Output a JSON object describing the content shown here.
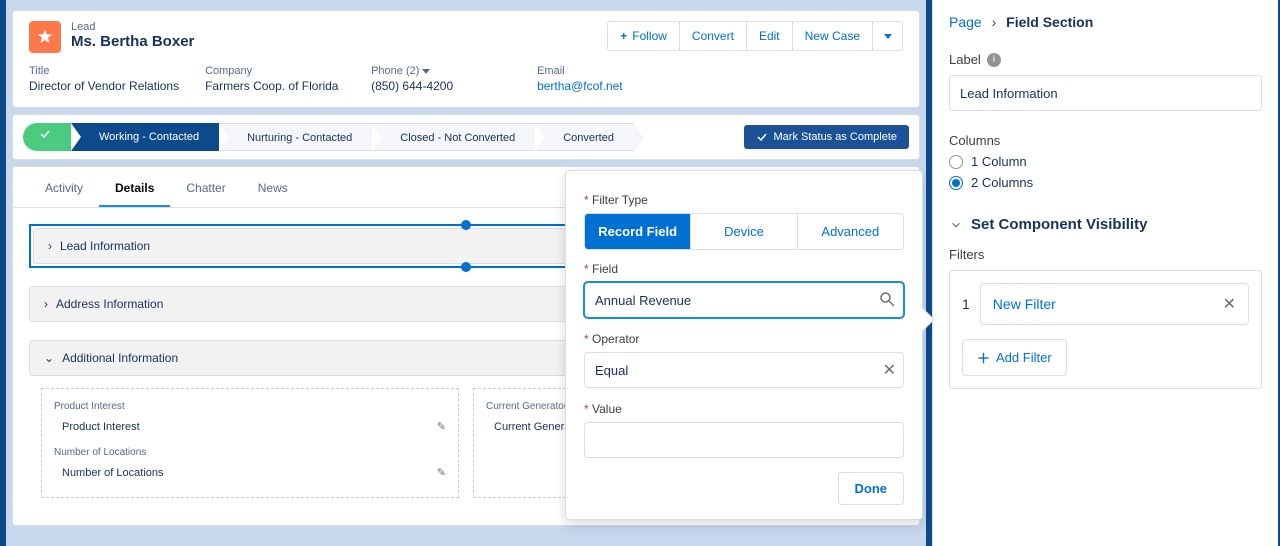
{
  "header": {
    "record_type": "Lead",
    "record_name": "Ms. Bertha Boxer",
    "actions": {
      "follow": "Follow",
      "convert": "Convert",
      "edit": "Edit",
      "new_case": "New Case"
    },
    "fields": [
      {
        "label": "Title",
        "value": "Director of Vendor Relations"
      },
      {
        "label": "Company",
        "value": "Farmers Coop. of Florida"
      },
      {
        "label": "Phone (2)",
        "value": "(850) 644-4200"
      },
      {
        "label": "Email",
        "value": "bertha@fcof.net",
        "is_link": true
      }
    ]
  },
  "path": {
    "stages": [
      "",
      "Working - Contacted",
      "Nurturing - Contacted",
      "Closed - Not Converted",
      "Converted"
    ],
    "complete_label": "Mark Status as Complete"
  },
  "tabs": [
    "Activity",
    "Details",
    "Chatter",
    "News"
  ],
  "active_tab": "Details",
  "sections": {
    "lead_info": "Lead Information",
    "address_info": "Address Information",
    "additional_info": "Additional Information",
    "fields_left": [
      {
        "label": "Product Interest",
        "value": "Product Interest"
      },
      {
        "label": "Number of Locations",
        "value": "Number of Locations"
      }
    ],
    "fields_right": [
      {
        "label": "Current Generator(s)",
        "value": "Current Generator(s)"
      }
    ]
  },
  "popover": {
    "filter_type_label": "Filter Type",
    "segments": [
      "Record Field",
      "Device",
      "Advanced"
    ],
    "active_segment": "Record Field",
    "field_label": "Field",
    "field_value": "Annual Revenue",
    "operator_label": "Operator",
    "operator_value": "Equal",
    "value_label": "Value",
    "value_value": "",
    "done": "Done"
  },
  "right": {
    "breadcrumb_page": "Page",
    "breadcrumb_current": "Field Section",
    "label_label": "Label",
    "label_value": "Lead Information",
    "columns_label": "Columns",
    "col_options": [
      "1 Column",
      "2 Columns"
    ],
    "selected_col": "2 Columns",
    "scv_title": "Set Component Visibility",
    "filters_label": "Filters",
    "filter_index": "1",
    "new_filter": "New Filter",
    "add_filter": "Add Filter"
  }
}
